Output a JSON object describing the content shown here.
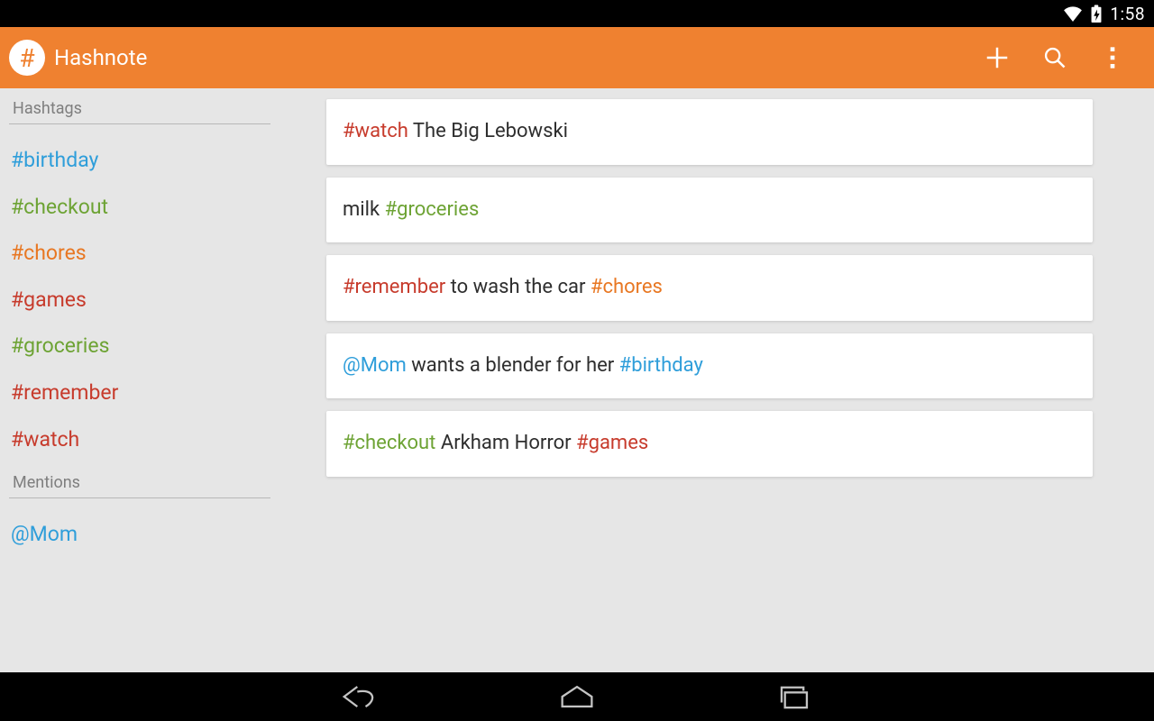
{
  "statusbar": {
    "time": "1:58"
  },
  "actionbar": {
    "logo_glyph": "#",
    "title": "Hashnote"
  },
  "sidebar": {
    "hashtags_label": "Hashtags",
    "mentions_label": "Mentions",
    "hashtags": [
      {
        "text": "#birthday",
        "color": "blue"
      },
      {
        "text": "#checkout",
        "color": "green"
      },
      {
        "text": "#chores",
        "color": "orange"
      },
      {
        "text": "#games",
        "color": "red"
      },
      {
        "text": "#groceries",
        "color": "green"
      },
      {
        "text": "#remember",
        "color": "red"
      },
      {
        "text": "#watch",
        "color": "red"
      }
    ],
    "mentions": [
      {
        "text": "@Mom",
        "color": "blue"
      }
    ]
  },
  "notes": [
    {
      "tokens": [
        {
          "text": "#watch",
          "color": "red"
        },
        {
          "text": " The Big Lebowski",
          "color": "text"
        }
      ]
    },
    {
      "tokens": [
        {
          "text": "milk ",
          "color": "text"
        },
        {
          "text": "#groceries",
          "color": "green"
        }
      ]
    },
    {
      "tokens": [
        {
          "text": "#remember",
          "color": "red"
        },
        {
          "text": " to wash the car ",
          "color": "text"
        },
        {
          "text": "#chores",
          "color": "orange"
        }
      ]
    },
    {
      "tokens": [
        {
          "text": "@Mom",
          "color": "blue"
        },
        {
          "text": " wants a blender for her ",
          "color": "text"
        },
        {
          "text": "#birthday",
          "color": "blue"
        }
      ]
    },
    {
      "tokens": [
        {
          "text": "#checkout",
          "color": "green"
        },
        {
          "text": " Arkham Horror ",
          "color": "text"
        },
        {
          "text": "#games",
          "color": "red"
        }
      ]
    }
  ]
}
